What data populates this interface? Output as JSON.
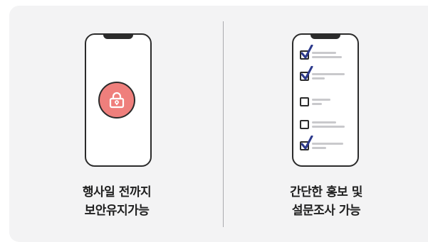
{
  "left_panel": {
    "caption_line1": "행사일 전까지",
    "caption_line2": "보안유지가능",
    "icon": "lock-icon"
  },
  "right_panel": {
    "caption_line1": "간단한 홍보 및",
    "caption_line2": "설문조사 가능",
    "checklist": [
      {
        "checked": true
      },
      {
        "checked": true
      },
      {
        "checked": false
      },
      {
        "checked": false
      },
      {
        "checked": true
      }
    ]
  },
  "colors": {
    "card_bg": "#f3f3f4",
    "accent_pink": "#ef7f7c",
    "check_blue": "#2d3a8c",
    "outline": "#2b2b2b"
  }
}
